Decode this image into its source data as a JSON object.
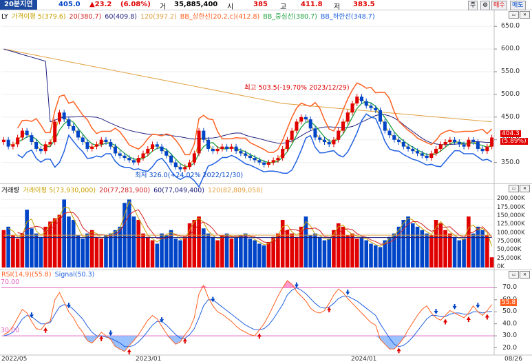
{
  "header": {
    "period_label": "20분지연",
    "price": "405.0",
    "change": "▲23.2",
    "change_pct": "(6.08%)",
    "volume_label": "거",
    "volume": "35,885,400",
    "open_label": "시",
    "open": "385",
    "high_label": "고",
    "high": "411.8",
    "low_label": "저",
    "low": "383.5",
    "btn_type": "주",
    "btn_gear": "⚙",
    "btn_buy": "매수",
    "btn_sell": "매도",
    "colors": {
      "up": "#e00000",
      "down": "#0045c8"
    }
  },
  "price_pane": {
    "legend": {
      "symbol": "LY",
      "ma5": "가격이평 5(379.6)",
      "ma20": "20(380.7)",
      "ma60": "60(409.8)",
      "ma120": "120(397.2)",
      "bb_upper": "BB_상한선(20,2,c)(412.8)",
      "bb_mid": "BB_중심선(380.7)",
      "bb_lower": "BB_하한선(348.7)"
    },
    "y_ticks": [
      "650.0",
      "600.0",
      "550.0",
      "500.0",
      "450.0",
      "400.0",
      "350.0"
    ],
    "annotation_high": "최고 503.5(-19.70% 2023/12/29)",
    "annotation_low": "최저 326.0(+24.02% 2022/12/30)",
    "last_price": "404.3",
    "last_pct": "(5.89%)"
  },
  "volume_pane": {
    "legend": {
      "title": "거래량",
      "ma5": "거래이평 5(73,930,000)",
      "ma20": "20(77,281,900)",
      "ma60": "60(77,049,400)",
      "ma120": "120(82,809,058)"
    },
    "y_ticks": [
      "200,000K",
      "175,000K",
      "150,000K",
      "125,000K",
      "100,000K",
      "75,000K",
      "50,000K",
      "25,000K",
      "0K"
    ]
  },
  "rsi_pane": {
    "legend": {
      "rsi": "RSI(14,9)(55.8)",
      "signal": "Signal(50.3)"
    },
    "y_ticks": [
      "70.0",
      "60.0",
      "50.0",
      "40.0",
      "30.0",
      "20.0"
    ],
    "upper_level": "70.00",
    "lower_level": "30.00",
    "last_value": "55.8"
  },
  "x_axis": {
    "labels": [
      "2022/05",
      "2023/01",
      "2024/01",
      "08/26"
    ]
  },
  "chart_data": {
    "type": "candlestick",
    "price_ma_colors": {
      "ma5": "#c8a000",
      "ma20": "#d02020",
      "ma60": "#202080",
      "ma120": "#e0a040",
      "bb_upper": "#ff6020",
      "bb_mid": "#20a040",
      "bb_lower": "#2060e0"
    },
    "note_series": "Weekly candles, approximate",
    "closes": [
      400,
      385,
      390,
      405,
      420,
      410,
      395,
      380,
      375,
      390,
      395,
      440,
      460,
      445,
      430,
      420,
      405,
      395,
      380,
      385,
      390,
      400,
      395,
      385,
      370,
      365,
      360,
      355,
      350,
      360,
      370,
      380,
      390,
      385,
      375,
      365,
      350,
      340,
      335,
      340,
      350,
      370,
      420,
      400,
      380,
      375,
      380,
      385,
      380,
      385,
      375,
      370,
      365,
      360,
      355,
      350,
      345,
      350,
      355,
      360,
      380,
      400,
      420,
      440,
      450,
      445,
      425,
      405,
      400,
      395,
      390,
      400,
      420,
      440,
      460,
      480,
      495,
      485,
      475,
      470,
      465,
      440,
      420,
      410,
      400,
      395,
      385,
      380,
      375,
      370,
      365,
      360,
      370,
      380,
      390,
      395,
      400,
      395,
      390,
      385,
      400,
      395,
      380,
      375,
      385,
      405
    ],
    "volumes": [
      110,
      120,
      95,
      85,
      100,
      170,
      115,
      100,
      90,
      120,
      135,
      145,
      155,
      200,
      150,
      140,
      95,
      85,
      100,
      110,
      90,
      85,
      95,
      100,
      110,
      120,
      190,
      200,
      150,
      140,
      100,
      90,
      80,
      70,
      100,
      95,
      110,
      85,
      80,
      90,
      130,
      140,
      150,
      115,
      100,
      90,
      80,
      95,
      100,
      85,
      90,
      95,
      100,
      85,
      80,
      70,
      65,
      75,
      90,
      100,
      140,
      110,
      100,
      90,
      120,
      150,
      95,
      100,
      90,
      80,
      85,
      110,
      130,
      120,
      95,
      100,
      85,
      90,
      80,
      70,
      65,
      60,
      80,
      90,
      100,
      120,
      140,
      150,
      130,
      120,
      110,
      100,
      95,
      140,
      130,
      110,
      100,
      90,
      80,
      85,
      150,
      100,
      120,
      110,
      95,
      30
    ],
    "rsi": [
      31,
      33,
      38,
      45,
      52,
      49,
      42,
      36,
      35,
      40,
      42,
      60,
      66,
      58,
      50,
      45,
      38,
      33,
      26,
      24,
      28,
      33,
      30,
      27,
      21,
      19,
      17,
      22,
      26,
      31,
      37,
      43,
      47,
      44,
      38,
      32,
      27,
      23,
      25,
      31,
      36,
      45,
      65,
      72,
      62,
      55,
      50,
      48,
      45,
      42,
      38,
      35,
      33,
      31,
      30,
      35,
      40,
      47,
      55,
      63,
      70,
      76,
      73,
      67,
      63,
      59,
      53,
      50,
      49,
      51,
      57,
      64,
      69,
      66,
      61,
      57,
      53,
      49,
      45,
      41,
      39,
      27,
      23,
      19,
      19,
      23,
      28,
      35,
      41,
      47,
      52,
      55,
      49,
      45,
      43,
      47,
      51,
      49,
      47,
      45,
      49,
      55,
      50,
      47,
      51,
      56
    ],
    "signal": [
      30,
      31,
      33,
      38,
      44,
      47,
      46,
      43,
      40,
      40,
      41,
      48,
      54,
      56,
      55,
      52,
      48,
      44,
      38,
      33,
      30,
      30,
      29,
      28,
      26,
      24,
      21,
      21,
      22,
      25,
      29,
      34,
      39,
      42,
      42,
      39,
      35,
      31,
      28,
      28,
      31,
      36,
      45,
      55,
      60,
      60,
      57,
      54,
      51,
      48,
      45,
      42,
      39,
      37,
      35,
      35,
      36,
      39,
      44,
      50,
      56,
      64,
      68,
      70,
      68,
      65,
      61,
      57,
      54,
      53,
      54,
      57,
      61,
      63,
      63,
      61,
      59,
      56,
      53,
      50,
      47,
      40,
      34,
      28,
      23,
      21,
      22,
      25,
      29,
      34,
      39,
      44,
      47,
      47,
      46,
      46,
      48,
      49,
      49,
      48,
      48,
      50,
      50,
      49,
      50,
      50.3
    ]
  }
}
